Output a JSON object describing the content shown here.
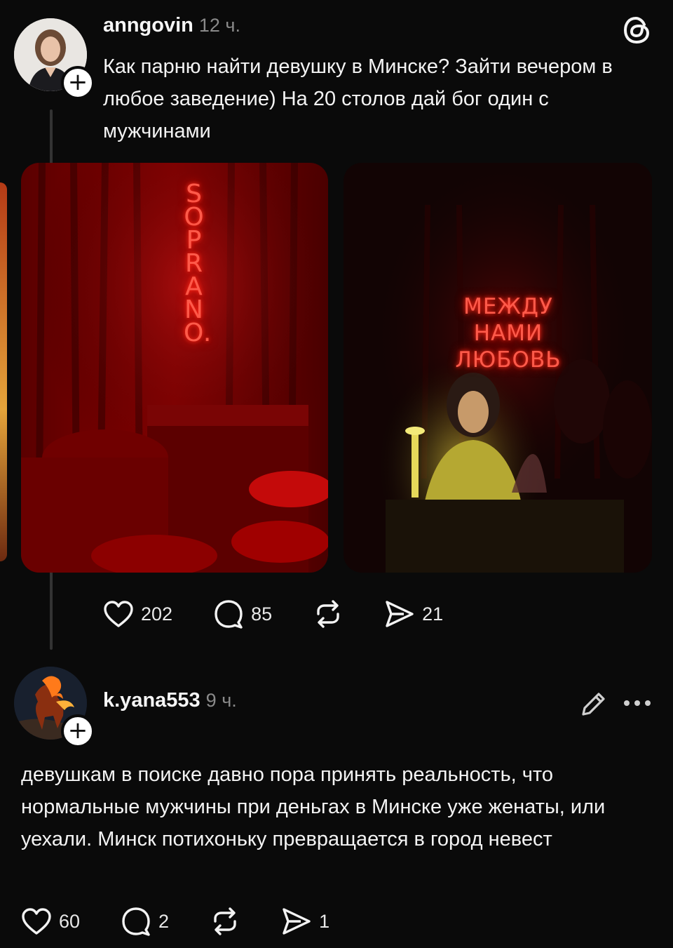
{
  "post": {
    "username": "anngovin",
    "time": "12 ч.",
    "text": "Как парню найти девушку в Минске? Зайти вечером в любое заведение) На 20 столов дай бог один с мужчинами",
    "images": [
      {
        "sign_text": "SOPRANO."
      },
      {
        "sign_lines": [
          "МЕЖДУ",
          "НАМИ",
          "ЛЮБОВЬ"
        ]
      }
    ],
    "likes": "202",
    "replies": "85",
    "shares": "21"
  },
  "reply": {
    "username": "k.yana553",
    "time": "9 ч.",
    "text": "девушкам в поиске давно пора принять реальность, что нормальные мужчины при деньгах в Минске уже женаты, или уехали. Минск потихоньку превращается в город невест",
    "likes": "60",
    "replies": "2",
    "shares": "1"
  },
  "icons": {
    "app_logo": "threads-icon",
    "follow": "plus-icon",
    "edit": "pencil-icon",
    "more": "more-icon",
    "like": "heart-icon",
    "reply": "comment-icon",
    "repost": "repost-icon",
    "share": "send-icon"
  },
  "colors": {
    "background": "#0a0a0a",
    "text": "#f3f3f3",
    "muted": "#8a8a8a",
    "neon": "#ff3b2f"
  }
}
